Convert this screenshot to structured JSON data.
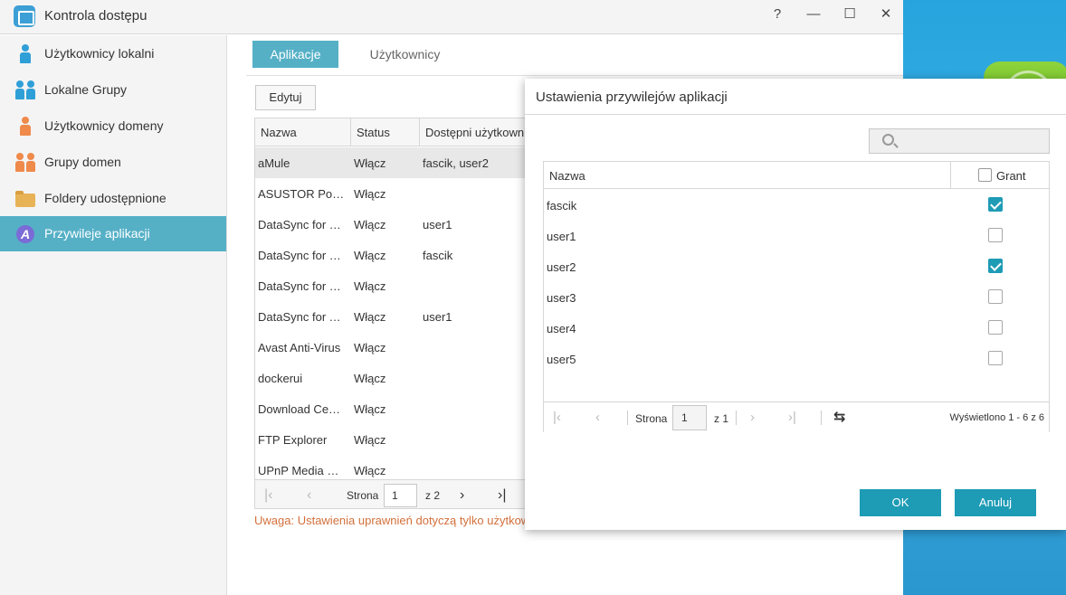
{
  "window": {
    "title": "Kontrola dostępu",
    "controls": {
      "help": "?",
      "minimize": "—",
      "maximize": "☐",
      "close": "✕"
    }
  },
  "sidebar": {
    "items": [
      {
        "label": "Użytkownicy lokalni",
        "icon": "user-icon"
      },
      {
        "label": "Lokalne Grupy",
        "icon": "group-icon"
      },
      {
        "label": "Użytkownicy domeny",
        "icon": "domain-user-icon"
      },
      {
        "label": "Grupy domen",
        "icon": "domain-group-icon"
      },
      {
        "label": "Foldery udostępnione",
        "icon": "folder-icon"
      },
      {
        "label": "Przywileje aplikacji",
        "icon": "app-privilege-icon",
        "active": true
      }
    ]
  },
  "tabs": [
    {
      "label": "Aplikacje",
      "active": true
    },
    {
      "label": "Użytkownicy",
      "active": false
    }
  ],
  "toolbar": {
    "edit_label": "Edytuj"
  },
  "apps_table": {
    "columns": [
      "Nazwa",
      "Status",
      "Dostępni użytkownicy"
    ],
    "rows": [
      {
        "name": "aMule",
        "status": "Włącz",
        "users": "fascik, user2",
        "selected": true
      },
      {
        "name": "ASUSTOR Portal",
        "status": "Włącz",
        "users": ""
      },
      {
        "name": "DataSync for Dropbox",
        "status": "Włącz",
        "users": "user1"
      },
      {
        "name": "DataSync for Microsoft OneDrive",
        "status": "Włącz",
        "users": "fascik"
      },
      {
        "name": "DataSync for Google Drive",
        "status": "Włącz",
        "users": ""
      },
      {
        "name": "DataSync for Yandex",
        "status": "Włącz",
        "users": "user1"
      },
      {
        "name": "Avast Anti-Virus",
        "status": "Włącz",
        "users": ""
      },
      {
        "name": "dockerui",
        "status": "Włącz",
        "users": ""
      },
      {
        "name": "Download Center",
        "status": "Włącz",
        "users": ""
      },
      {
        "name": "FTP Explorer",
        "status": "Włącz",
        "users": ""
      },
      {
        "name": "UPnP Media Server",
        "status": "Włącz",
        "users": ""
      }
    ],
    "pager": {
      "page_label": "Strona",
      "page": "1",
      "of_label": "z 2"
    }
  },
  "note": "Uwaga: Ustawienia uprawnień dotyczą tylko użytkowników lokalnych",
  "dialog": {
    "title": "Ustawienia przywilejów aplikacji",
    "search_placeholder": "",
    "columns": {
      "name": "Nazwa",
      "grant": "Grant"
    },
    "users": [
      {
        "name": "fascik",
        "granted": true
      },
      {
        "name": "user1",
        "granted": false
      },
      {
        "name": "user2",
        "granted": true
      },
      {
        "name": "user3",
        "granted": false
      },
      {
        "name": "user4",
        "granted": false
      },
      {
        "name": "user5",
        "granted": false
      }
    ],
    "pager": {
      "page_label": "Strona",
      "page": "1",
      "of_label": "z 1",
      "info": "Wyświetlono 1 - 6 z 6"
    },
    "ok_label": "OK",
    "cancel_label": "Anuluj"
  },
  "colors": {
    "accent": "#55b0c6",
    "button": "#1e9bb5",
    "warning": "#d3703b"
  }
}
